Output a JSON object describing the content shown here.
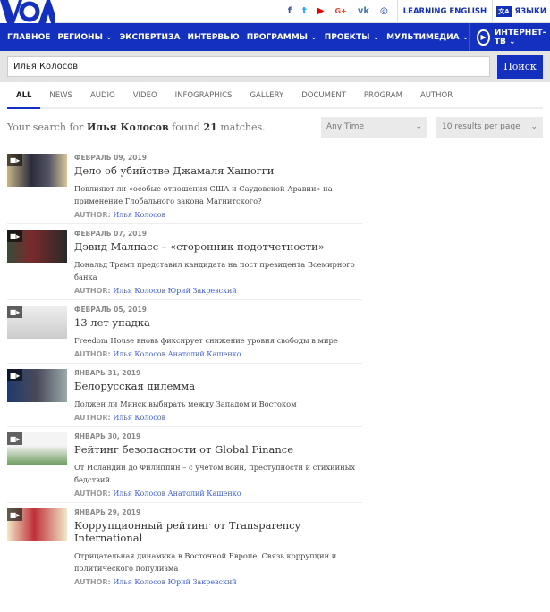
{
  "header": {
    "logo": "VOA",
    "learning_english": "LEARNING ENGLISH",
    "languages": "ЯЗЫКИ",
    "social": [
      "f",
      "t",
      "▶",
      "G+",
      "vk",
      "◎"
    ]
  },
  "nav": {
    "items": [
      "ГЛАВНОЕ",
      "РЕГИОНЫ ⌄",
      "ЭКСПЕРТИЗА",
      "ИНТЕРВЬЮ",
      "ПРОГРАММЫ ⌄",
      "ПРОЕКТЫ ⌄",
      "МУЛЬТИМЕДИА ⌄"
    ],
    "tv": "ИНТЕРНЕТ-ТВ ⌄"
  },
  "search": {
    "value": "Илья Колосов",
    "button": "Поиск"
  },
  "tabs": [
    "ALL",
    "NEWS",
    "AUDIO",
    "VIDEO",
    "INFOGRAPHICS",
    "GALLERY",
    "DOCUMENT",
    "PROGRAM",
    "AUTHOR"
  ],
  "summary": {
    "prefix": "Your search for ",
    "query": "Илья Колосов",
    "mid": " found ",
    "count": "21",
    "suffix": " matches."
  },
  "filters": {
    "time": "Any Time",
    "per_page": "10 results per page"
  },
  "author_label": "AUTHOR:",
  "results": [
    {
      "date": "ФЕВРАЛЬ 09, 2019",
      "title": "Дело об убийстве Джамаля Хашогги",
      "desc": "Повлияют ли «особые отношения США и Саудовской Аравии» на применение Глобального закона Магнитского?",
      "authors": "Илья Колосов"
    },
    {
      "date": "ФЕВРАЛЬ 07, 2019",
      "title": "Дэвид Малпасс – «сторонник подотчетности»",
      "desc": "Дональд Трамп представил кандидата на пост президента Всемирного банка",
      "authors": "Илья Колосов Юрий Закревский"
    },
    {
      "date": "ФЕВРАЛЬ 05, 2019",
      "title": "13 лет упадка",
      "desc": "Freedom House вновь фиксирует снижение уровня свободы в мире",
      "authors": "Илья Колосов Анатолий Кашенко"
    },
    {
      "date": "ЯНВАРЬ 31, 2019",
      "title": "Белорусская дилемма",
      "desc": "Должен ли Минск выбирать между Западом и Востоком",
      "authors": "Илья Колосов"
    },
    {
      "date": "ЯНВАРЬ 30, 2019",
      "title": "Рейтинг безопасности от Global Finance",
      "desc": "От Исландии до Филиппин – с учетом войн, преступности и стихийных бедствий",
      "authors": "Илья Колосов Анатолий Кашенко"
    },
    {
      "date": "ЯНВАРЬ 29, 2019",
      "title": "Коррупционный рейтинг от Transparency International",
      "desc": "Отрицательная динамика в Восточной Европе. Связь коррупции и политического популизма",
      "authors": "Илья Колосов Юрий Закревский"
    }
  ]
}
